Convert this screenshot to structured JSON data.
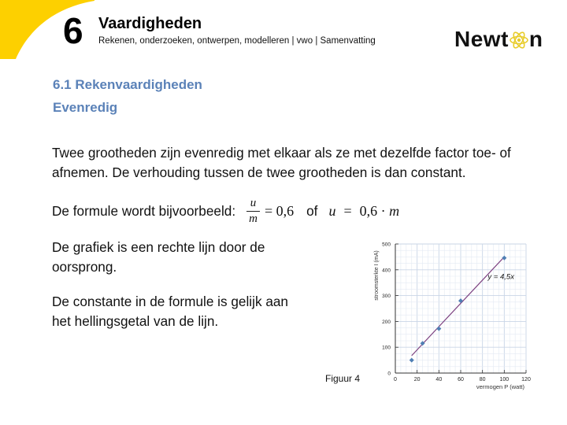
{
  "header": {
    "chapter_number": "6",
    "title": "Vaardigheden",
    "subtitle": "Rekenen, onderzoeken, ontwerpen, modelleren | vwo | Samenvatting",
    "logo_text_left": "Newt",
    "logo_text_right": "n",
    "logo_icon": "atom-icon",
    "accent_color": "#fdd000"
  },
  "section": {
    "title": "6.1  Rekenvaardigheden",
    "subtitle": "Evenredig",
    "color": "#5b82b8"
  },
  "body": {
    "paragraph1": "Twee grootheden zijn evenredig met elkaar als ze met dezelfde factor toe- of afnemen. De verhouding tussen de twee grootheden is dan constant.",
    "formula_intro": "De formule wordt bijvoorbeeld:",
    "formula1_numerator": "u",
    "formula1_denominator": "m",
    "formula1_rhs": "= 0,6",
    "formula_or": "of",
    "formula2_lhs": "u",
    "formula2_eq": "=",
    "formula2_rhs": "0,6 · ",
    "formula2_var": "m",
    "paragraph2": "De grafiek is een rechte lijn door de oorsprong.",
    "paragraph3": "De constante in de formule is gelijk aan het hellingsgetal van de lijn.",
    "figure_caption": "Figuur 4"
  },
  "chart_data": {
    "type": "scatter",
    "title": "",
    "xlabel": "vermogen P (watt)",
    "ylabel": "stroomsterkte I (mA)",
    "xlim": [
      0,
      120
    ],
    "ylim": [
      0,
      500
    ],
    "xticks": [
      0,
      20,
      40,
      60,
      80,
      100,
      120
    ],
    "yticks": [
      0,
      100,
      200,
      300,
      400,
      500
    ],
    "grid": true,
    "points": [
      {
        "x": 15,
        "y": 50
      },
      {
        "x": 25,
        "y": 115
      },
      {
        "x": 40,
        "y": 172
      },
      {
        "x": 60,
        "y": 280
      },
      {
        "x": 100,
        "y": 446
      }
    ],
    "fit_line": {
      "slope": 4.5,
      "x_range": [
        15,
        100
      ],
      "label": "y = 4,5x"
    },
    "point_color": "#4f7fb4",
    "line_color": "#7b3f7f"
  }
}
